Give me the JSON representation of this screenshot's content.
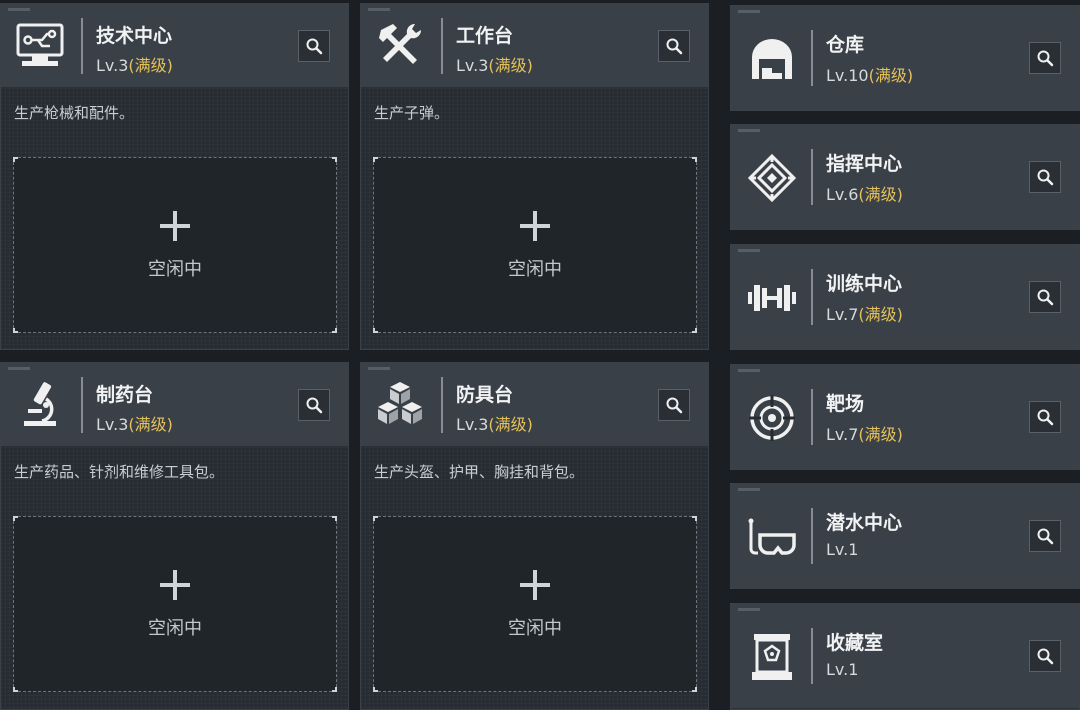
{
  "level_prefix": "Lv.",
  "max_label": "(满级)",
  "idle_label": "空闲中",
  "accent_color": "#e4c15a",
  "big_cards": [
    {
      "name": "技术中心",
      "level": "3",
      "is_max": true,
      "desc": "生产枪械和配件。",
      "icon": "computer-icon"
    },
    {
      "name": "工作台",
      "level": "3",
      "is_max": true,
      "desc": "生产子弹。",
      "icon": "hammer-wrench-icon"
    },
    {
      "name": "制药台",
      "level": "3",
      "is_max": true,
      "desc": "生产药品、针剂和维修工具包。",
      "icon": "microscope-icon"
    },
    {
      "name": "防具台",
      "level": "3",
      "is_max": true,
      "desc": "生产头盔、护甲、胸挂和背包。",
      "icon": "cubes-icon"
    }
  ],
  "small_cards": [
    {
      "name": "仓库",
      "level": "10",
      "is_max": true,
      "icon": "warehouse-icon"
    },
    {
      "name": "指挥中心",
      "level": "6",
      "is_max": true,
      "icon": "command-emblem-icon"
    },
    {
      "name": "训练中心",
      "level": "7",
      "is_max": true,
      "icon": "dumbbell-icon"
    },
    {
      "name": "靶场",
      "level": "7",
      "is_max": true,
      "icon": "target-icon"
    },
    {
      "name": "潜水中心",
      "level": "1",
      "is_max": false,
      "icon": "diving-mask-icon"
    },
    {
      "name": "收藏室",
      "level": "1",
      "is_max": false,
      "icon": "display-case-icon"
    }
  ]
}
